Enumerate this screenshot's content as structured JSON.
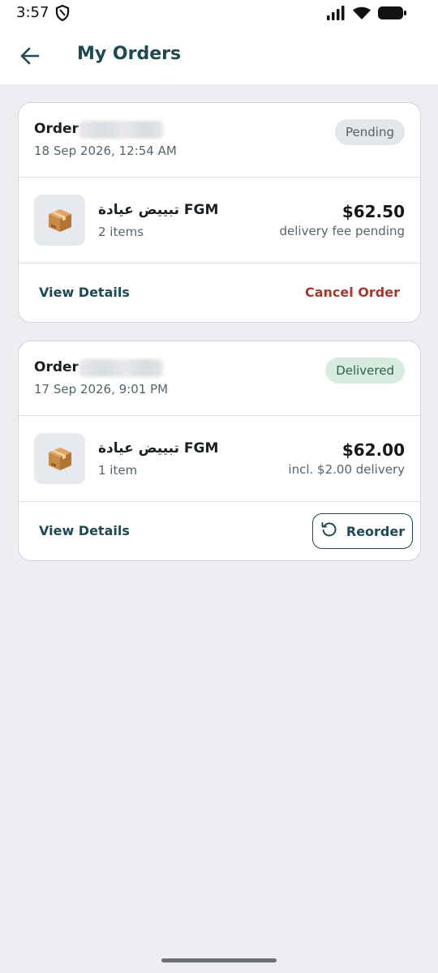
{
  "status_bar": {
    "time": "3:57"
  },
  "header": {
    "title": "My Orders"
  },
  "orders": [
    {
      "label": "Order",
      "id": "",
      "date": "18 Sep 2026, 12:54 AM",
      "status": "Pending",
      "item_name": "تبييض عيادة FGM",
      "item_count": "2 items",
      "price": "$62.50",
      "price_note": "delivery fee pending",
      "view_label": "View Details",
      "action_label": "Cancel Order"
    },
    {
      "label": "Order",
      "id": "",
      "date": "17 Sep 2026, 9:01 PM",
      "status": "Delivered",
      "item_name": "تبييض عيادة FGM",
      "item_count": "1 item",
      "price": "$62.00",
      "price_note": "incl. $2.00 delivery",
      "view_label": "View Details",
      "action_label": "Reorder"
    }
  ],
  "colors": {
    "accent": "#1d4a55",
    "danger": "#a33a2e",
    "pending_badge": "#e4e7ea",
    "delivered_badge": "#d6ecdf",
    "background": "#eceef2"
  },
  "icons": [
    "shield-icon",
    "signal-icon",
    "wifi-icon",
    "battery-icon",
    "back-arrow-icon",
    "package-icon",
    "reorder-icon"
  ]
}
